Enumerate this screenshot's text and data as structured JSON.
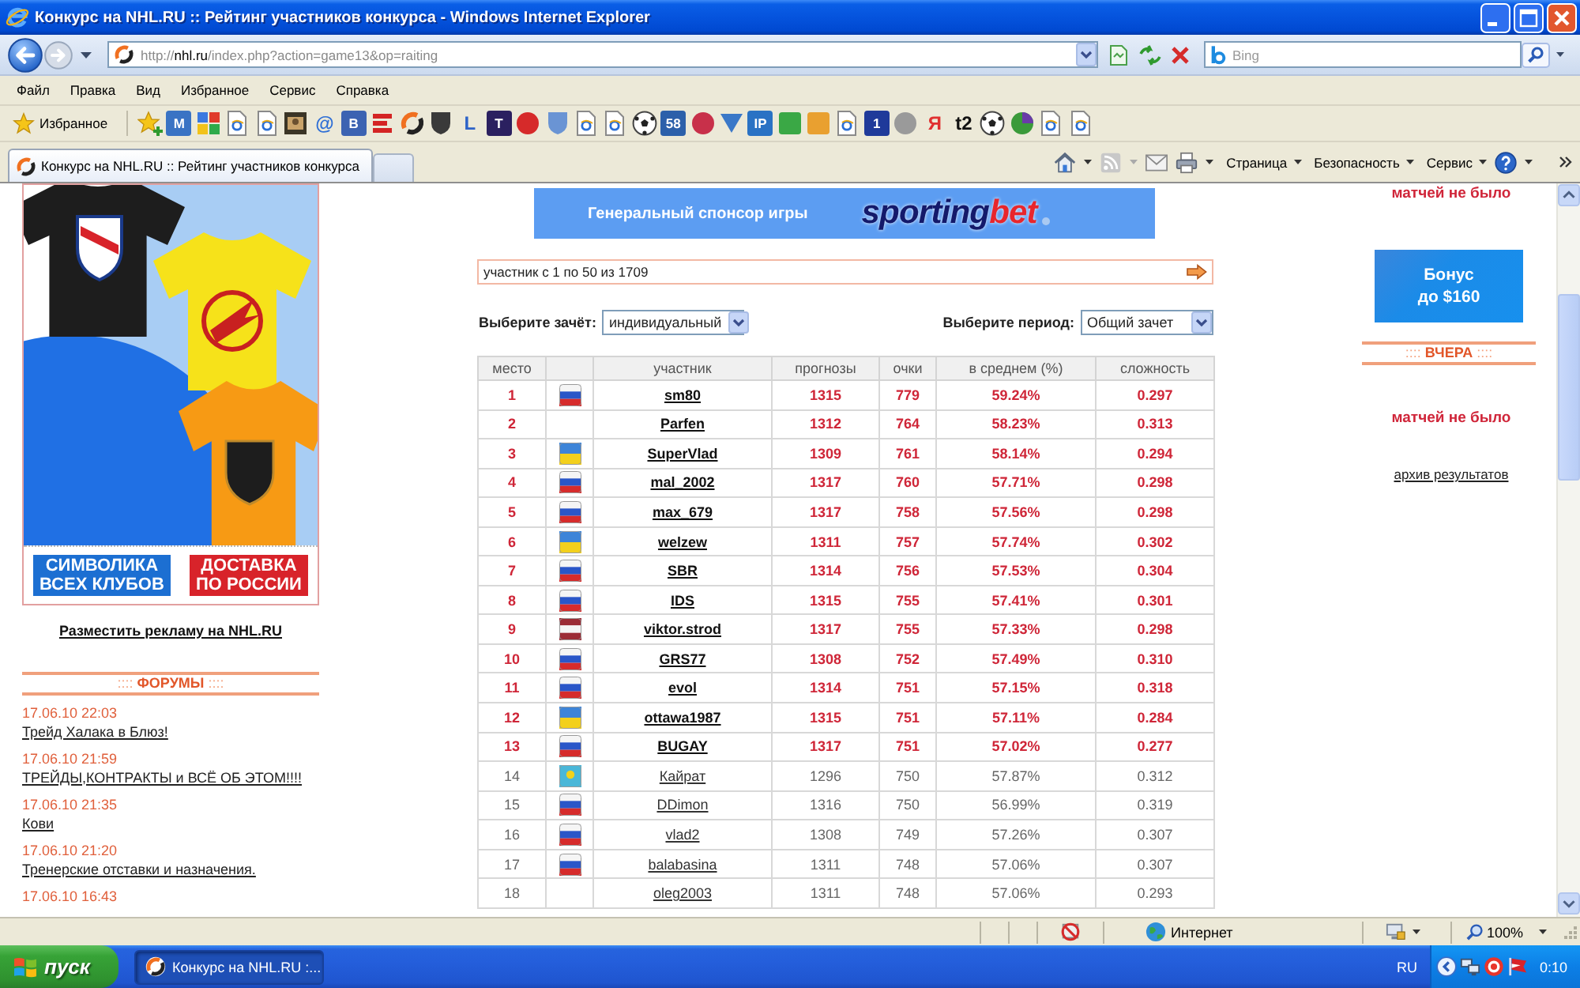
{
  "window": {
    "title": "Конкурс на NHL.RU :: Рейтинг участников конкурса - Windows Internet Explorer"
  },
  "address_bar": {
    "scheme": "http://",
    "domain": "nhl.ru",
    "path": "/index.php?action=game13&op=raiting",
    "search_placeholder": "Bing"
  },
  "menu": [
    "Файл",
    "Правка",
    "Вид",
    "Избранное",
    "Сервис",
    "Справка"
  ],
  "favorites_bar": {
    "label": "Избранное",
    "links": [
      {
        "kind": "add"
      },
      {
        "kind": "tile",
        "label": "M",
        "color": "#3a73c4"
      },
      {
        "kind": "google"
      },
      {
        "kind": "page"
      },
      {
        "kind": "page"
      },
      {
        "kind": "photo"
      },
      {
        "kind": "glyph",
        "label": "@",
        "color": "#2f6fd6"
      },
      {
        "kind": "tile",
        "label": "B",
        "color": "#3c63b2"
      },
      {
        "kind": "stripes",
        "color": "#d42424"
      },
      {
        "kind": "swirl"
      },
      {
        "kind": "shield",
        "color": "#3a3a3a"
      },
      {
        "kind": "glyph",
        "label": "L",
        "color": "#2d63c8"
      },
      {
        "kind": "tile",
        "label": "T",
        "color": "#2b2060"
      },
      {
        "kind": "badge",
        "color": "#d62a2a"
      },
      {
        "kind": "shield",
        "color": "#6a94d4"
      },
      {
        "kind": "page"
      },
      {
        "kind": "page"
      },
      {
        "kind": "ball"
      },
      {
        "kind": "tile",
        "label": "58",
        "color": "#2c60aa"
      },
      {
        "kind": "badge",
        "color": "#c8304a"
      },
      {
        "kind": "triangle",
        "color": "#3a78c8"
      },
      {
        "kind": "tile",
        "label": "IP",
        "color": "#2a72c4"
      },
      {
        "kind": "square",
        "color": "#3aa845"
      },
      {
        "kind": "square",
        "color": "#e9a030"
      },
      {
        "kind": "page"
      },
      {
        "kind": "tile",
        "label": "1",
        "color": "#1f3a9a"
      },
      {
        "kind": "badge",
        "color": "#9a9a9a"
      },
      {
        "kind": "glyph",
        "label": "Я",
        "color": "#e03030"
      },
      {
        "kind": "glyph",
        "label": "t2",
        "color": "#111111"
      },
      {
        "kind": "ball"
      },
      {
        "kind": "globe"
      },
      {
        "kind": "page"
      },
      {
        "kind": "page"
      }
    ]
  },
  "tabs": [
    {
      "title": "Конкурс на NHL.RU :: Рейтинг участников конкурса",
      "selected": true
    }
  ],
  "command_bar": {
    "menus": [
      "Страница",
      "Безопасность",
      "Сервис"
    ]
  },
  "left_column": {
    "banner_captions": [
      {
        "lines": [
          "СИМВОЛИКА",
          "ВСЕХ КЛУБОВ"
        ],
        "color": "#1c6fd2"
      },
      {
        "lines": [
          "ДОСТАВКА",
          "ПО РОССИИ"
        ],
        "color": "#d8232a"
      }
    ],
    "ad_link": "Разместить рекламу на NHL.RU",
    "forum": {
      "heading": ":::: **ФОРУМЫ** ::::",
      "posts": [
        {
          "date": "17.06.10 22:03",
          "title": "Трейд Халака в Блюз!"
        },
        {
          "date": "17.06.10 21:59",
          "title": "ТРЕЙДЫ,КОНТРАКТЫ и ВСЁ ОБ ЭТОМ!!!!"
        },
        {
          "date": "17.06.10 21:35",
          "title": "Кови"
        },
        {
          "date": "17.06.10 21:20",
          "title": "Тренерские отставки и назначения."
        },
        {
          "date": "17.06.10 16:43"
        }
      ]
    }
  },
  "sponsor_banner": {
    "text": "Генеральный спонсор игры",
    "logo": [
      "sporting",
      "bet"
    ]
  },
  "pager": {
    "text": "участник с 1 по 50 из 1709"
  },
  "filters": [
    {
      "label": "Выберите зачёт:",
      "value": "индивидуальный"
    },
    {
      "label": "Выберите период:",
      "value": "Общий зачет"
    }
  ],
  "table": {
    "columns": [
      "место",
      "участник",
      "прогнозы",
      "очки",
      "в среднем (%)",
      "сложность"
    ],
    "rows": [
      {
        "place": "1",
        "flag": {
          "kind": "ru"
        },
        "name": "sm80",
        "forecasts": "1315",
        "points": "779",
        "average": "59.24%",
        "difficulty": "0.297",
        "highlighted": true
      },
      {
        "place": "2",
        "name": "Parfen",
        "forecasts": "1312",
        "points": "764",
        "average": "58.23%",
        "difficulty": "0.313",
        "highlighted": true
      },
      {
        "place": "3",
        "flag": {
          "kind": "ua"
        },
        "name": "SuperVlad",
        "forecasts": "1309",
        "points": "761",
        "average": "58.14%",
        "difficulty": "0.294",
        "highlighted": true
      },
      {
        "place": "4",
        "flag": {
          "kind": "ru"
        },
        "name": "mal_2002",
        "forecasts": "1317",
        "points": "760",
        "average": "57.71%",
        "difficulty": "0.298",
        "highlighted": true
      },
      {
        "place": "5",
        "flag": {
          "kind": "ru"
        },
        "name": "max_679",
        "forecasts": "1317",
        "points": "758",
        "average": "57.56%",
        "difficulty": "0.298",
        "highlighted": true
      },
      {
        "place": "6",
        "flag": {
          "kind": "ua"
        },
        "name": "welzew",
        "forecasts": "1311",
        "points": "757",
        "average": "57.74%",
        "difficulty": "0.302",
        "highlighted": true
      },
      {
        "place": "7",
        "flag": {
          "kind": "ru"
        },
        "name": "SBR",
        "forecasts": "1314",
        "points": "756",
        "average": "57.53%",
        "difficulty": "0.304",
        "highlighted": true
      },
      {
        "place": "8",
        "flag": {
          "kind": "ru"
        },
        "name": "IDS",
        "forecasts": "1315",
        "points": "755",
        "average": "57.41%",
        "difficulty": "0.301",
        "highlighted": true
      },
      {
        "place": "9",
        "flag": {
          "kind": "lv"
        },
        "name": "viktor.strod",
        "forecasts": "1317",
        "points": "755",
        "average": "57.33%",
        "difficulty": "0.298",
        "highlighted": true
      },
      {
        "place": "10",
        "flag": {
          "kind": "ru"
        },
        "name": "GRS77",
        "forecasts": "1308",
        "points": "752",
        "average": "57.49%",
        "difficulty": "0.310",
        "highlighted": true
      },
      {
        "place": "11",
        "flag": {
          "kind": "ru"
        },
        "name": "evol",
        "forecasts": "1314",
        "points": "751",
        "average": "57.15%",
        "difficulty": "0.318",
        "highlighted": true
      },
      {
        "place": "12",
        "flag": {
          "kind": "ua"
        },
        "name": "ottawa1987",
        "forecasts": "1315",
        "points": "751",
        "average": "57.11%",
        "difficulty": "0.284",
        "highlighted": true
      },
      {
        "place": "13",
        "flag": {
          "kind": "ru"
        },
        "name": "BUGAY",
        "forecasts": "1317",
        "points": "751",
        "average": "57.02%",
        "difficulty": "0.277",
        "highlighted": true
      },
      {
        "place": "14",
        "flag": {
          "kind": "kz"
        },
        "name": "Кайрат",
        "forecasts": "1296",
        "points": "750",
        "average": "57.87%",
        "difficulty": "0.312",
        "highlighted": false
      },
      {
        "place": "15",
        "flag": {
          "kind": "ru"
        },
        "name": "DDimon",
        "forecasts": "1316",
        "points": "750",
        "average": "56.99%",
        "difficulty": "0.319",
        "highlighted": false
      },
      {
        "place": "16",
        "flag": {
          "kind": "ru"
        },
        "name": "vlad2",
        "forecasts": "1308",
        "points": "749",
        "average": "57.26%",
        "difficulty": "0.307",
        "highlighted": false
      },
      {
        "place": "17",
        "flag": {
          "kind": "ru"
        },
        "name": "balabasina",
        "forecasts": "1311",
        "points": "748",
        "average": "57.06%",
        "difficulty": "0.307",
        "highlighted": false
      },
      {
        "place": "18",
        "name": "oleg2003",
        "forecasts": "1311",
        "points": "748",
        "average": "57.06%",
        "difficulty": "0.293",
        "highlighted": false
      }
    ]
  },
  "right_column": {
    "top_note": "матчей не было",
    "bonus": [
      "Бонус",
      "до $160"
    ],
    "heading": ":::: **ВЧЕРА** ::::",
    "note": "матчей не было",
    "archive_link": "архив результатов"
  },
  "status_bar": {
    "zone": "Интернет",
    "zoom": "100%"
  },
  "taskbar": {
    "start": "пуск",
    "tasks": [
      {
        "title": "Конкурс на NHL.RU :...",
        "selected": true
      }
    ],
    "language": "RU",
    "clock": "0:10"
  }
}
